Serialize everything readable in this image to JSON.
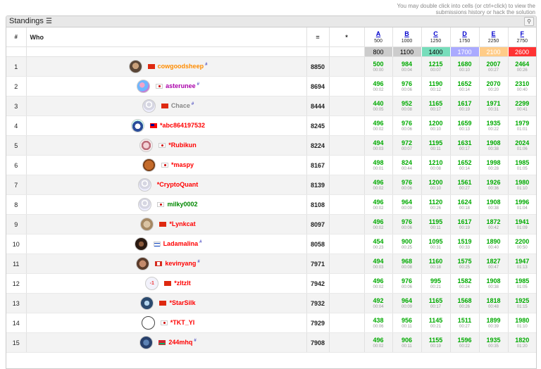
{
  "hint": "You may double click into cells (or ctrl+click) to view the submissions history or hack the solution",
  "panel": {
    "title": "Standings",
    "list_icon": "list-icon",
    "zoom_icon": "zoom-icon"
  },
  "header": {
    "rank": "#",
    "who": "Who",
    "score": "=",
    "hacks": "*"
  },
  "problems": [
    {
      "letter": "A",
      "points": "500",
      "rating": "800",
      "color": "#cccccc",
      "text": "#000"
    },
    {
      "letter": "B",
      "points": "1000",
      "rating": "1100",
      "color": "#cccccc",
      "text": "#000"
    },
    {
      "letter": "C",
      "points": "1250",
      "rating": "1400",
      "color": "#77ddbb",
      "text": "#000"
    },
    {
      "letter": "D",
      "points": "1750",
      "rating": "1700",
      "color": "#aaaaff",
      "text": "#fff"
    },
    {
      "letter": "E",
      "points": "2250",
      "rating": "2100",
      "color": "#ffcc88",
      "text": "#fff"
    },
    {
      "letter": "F",
      "points": "2750",
      "rating": "2600",
      "color": "#ff3333",
      "text": "#fff"
    }
  ],
  "rows": [
    {
      "rank": "1",
      "handle": "cowgoodsheep",
      "flag": "cn",
      "color": "c-orange",
      "star": "#",
      "avatar": "av-1",
      "score": "8850",
      "results": [
        [
          "500",
          "00:00"
        ],
        [
          "984",
          "00:04"
        ],
        [
          "1215",
          "00:07"
        ],
        [
          "1680",
          "00:10"
        ],
        [
          "2007",
          "00:27"
        ],
        [
          "2464",
          "00:26"
        ]
      ]
    },
    {
      "rank": "2",
      "handle": "asterunee",
      "flag": "kr",
      "color": "c-violet",
      "star": "#",
      "avatar": "av-2",
      "score": "8694",
      "results": [
        [
          "496",
          "00:02"
        ],
        [
          "976",
          "00:06"
        ],
        [
          "1190",
          "00:12"
        ],
        [
          "1652",
          "00:14"
        ],
        [
          "2070",
          "00:20"
        ],
        [
          "2310",
          "00:40"
        ]
      ]
    },
    {
      "rank": "3",
      "handle": "Chace",
      "flag": "cn",
      "color": "c-gray",
      "star": "#",
      "avatar": "av-def",
      "score": "8444",
      "results": [
        [
          "440",
          "00:05"
        ],
        [
          "952",
          "00:08"
        ],
        [
          "1165",
          "00:17"
        ],
        [
          "1617",
          "00:19"
        ],
        [
          "1971",
          "00:31"
        ],
        [
          "2299",
          "00:41"
        ]
      ]
    },
    {
      "rank": "4",
      "handle": "*abc864197532",
      "flag": "tw",
      "color": "c-red",
      "star": "",
      "avatar": "av-4",
      "score": "8245",
      "results": [
        [
          "496",
          "00:02"
        ],
        [
          "976",
          "00:06"
        ],
        [
          "1200",
          "00:10"
        ],
        [
          "1659",
          "00:13"
        ],
        [
          "1935",
          "00:22"
        ],
        [
          "1979",
          "01:01"
        ]
      ]
    },
    {
      "rank": "5",
      "handle": "*Rubikun",
      "flag": "jp",
      "color": "c-red",
      "star": "",
      "avatar": "av-5",
      "score": "8224",
      "results": [
        [
          "494",
          "00:03"
        ],
        [
          "972",
          "00:07"
        ],
        [
          "1195",
          "00:11"
        ],
        [
          "1631",
          "00:17"
        ],
        [
          "1908",
          "00:38"
        ],
        [
          "2024",
          "01:06"
        ]
      ]
    },
    {
      "rank": "6",
      "handle": "*maspy",
      "flag": "jp",
      "color": "c-red",
      "star": "",
      "avatar": "av-6",
      "score": "8167",
      "results": [
        [
          "498",
          "00:01"
        ],
        [
          "824",
          "00:44"
        ],
        [
          "1210",
          "00:08"
        ],
        [
          "1652",
          "00:14"
        ],
        [
          "1998",
          "00:28"
        ],
        [
          "1985",
          "01:05"
        ]
      ]
    },
    {
      "rank": "7",
      "handle": "*CryptoQuant",
      "flag": "",
      "color": "c-red",
      "star": "",
      "avatar": "av-def",
      "score": "8139",
      "results": [
        [
          "496",
          "00:02"
        ],
        [
          "976",
          "00:06"
        ],
        [
          "1200",
          "00:10"
        ],
        [
          "1561",
          "00:27"
        ],
        [
          "1926",
          "00:36"
        ],
        [
          "1980",
          "01:10"
        ]
      ]
    },
    {
      "rank": "8",
      "handle": "milky0002",
      "flag": "kr",
      "color": "c-green",
      "star": "",
      "avatar": "av-def",
      "score": "8108",
      "results": [
        [
          "496",
          "00:02"
        ],
        [
          "964",
          "00:09"
        ],
        [
          "1120",
          "00:26"
        ],
        [
          "1624",
          "00:18"
        ],
        [
          "1908",
          "00:38"
        ],
        [
          "1996",
          "01:04"
        ]
      ]
    },
    {
      "rank": "9",
      "handle": "*Lynkcat",
      "flag": "cn",
      "color": "c-red",
      "star": "",
      "avatar": "av-9",
      "score": "8097",
      "results": [
        [
          "496",
          "00:02"
        ],
        [
          "976",
          "00:06"
        ],
        [
          "1195",
          "00:11"
        ],
        [
          "1617",
          "00:19"
        ],
        [
          "1872",
          "00:42"
        ],
        [
          "1941",
          "01:09"
        ]
      ]
    },
    {
      "rank": "10",
      "handle": "Ladamalina",
      "flag": "il",
      "color": "c-red",
      "star": "#",
      "avatar": "av-10",
      "score": "8058",
      "results": [
        [
          "454",
          "00:23"
        ],
        [
          "900",
          "00:25"
        ],
        [
          "1095",
          "00:31"
        ],
        [
          "1519",
          "00:33"
        ],
        [
          "1890",
          "00:40"
        ],
        [
          "2200",
          "00:50"
        ]
      ]
    },
    {
      "rank": "11",
      "handle": "kevinyang",
      "flag": "ca",
      "color": "c-red",
      "star": "#",
      "avatar": "av-11",
      "score": "7971",
      "results": [
        [
          "494",
          "00:03"
        ],
        [
          "968",
          "00:08"
        ],
        [
          "1160",
          "00:18"
        ],
        [
          "1575",
          "00:25"
        ],
        [
          "1827",
          "00:47"
        ],
        [
          "1947",
          "01:13"
        ]
      ]
    },
    {
      "rank": "12",
      "handle": "*zltzlt",
      "flag": "cn",
      "color": "c-red",
      "star": "",
      "avatar": "av-12",
      "avatar_text": "-1",
      "score": "7942",
      "results": [
        [
          "496",
          "00:02"
        ],
        [
          "976",
          "00:06"
        ],
        [
          "995",
          "00:21"
        ],
        [
          "1582",
          "00:24"
        ],
        [
          "1908",
          "00:38"
        ],
        [
          "1985",
          "01:05"
        ]
      ]
    },
    {
      "rank": "13",
      "handle": "*StarSilk",
      "flag": "cn",
      "color": "c-red",
      "star": "",
      "avatar": "av-13",
      "score": "7932",
      "results": [
        [
          "492",
          "00:04"
        ],
        [
          "964",
          "00:09"
        ],
        [
          "1165",
          "00:17"
        ],
        [
          "1568",
          "00:26"
        ],
        [
          "1818",
          "00:48"
        ],
        [
          "1925",
          "01:15"
        ]
      ]
    },
    {
      "rank": "14",
      "handle": "*TKT_YI",
      "flag": "jp",
      "color": "c-red",
      "star": "",
      "avatar": "av-14",
      "score": "7929",
      "results": [
        [
          "438",
          "00:06"
        ],
        [
          "956",
          "00:11"
        ],
        [
          "1145",
          "00:21"
        ],
        [
          "1511",
          "00:27"
        ],
        [
          "1899",
          "00:39"
        ],
        [
          "1980",
          "01:10"
        ]
      ]
    },
    {
      "rank": "15",
      "handle": "244mhq",
      "flag": "by",
      "color": "c-red",
      "star": "#",
      "avatar": "av-15",
      "score": "7908",
      "results": [
        [
          "496",
          "00:02"
        ],
        [
          "906",
          "00:11"
        ],
        [
          "1155",
          "00:19"
        ],
        [
          "1596",
          "00:22"
        ],
        [
          "1935",
          "00:35"
        ],
        [
          "1820",
          "01:20"
        ]
      ]
    }
  ]
}
